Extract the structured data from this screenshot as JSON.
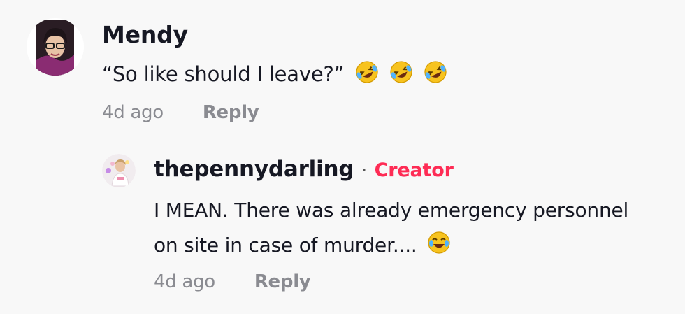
{
  "comments": [
    {
      "username": "Mendy",
      "text": "“So like should I leave?”",
      "emojis": [
        "rolling-on-floor-laughing-emoji",
        "rolling-on-floor-laughing-emoji",
        "rolling-on-floor-laughing-emoji"
      ],
      "time": "4d ago",
      "reply_label": "Reply"
    }
  ],
  "replies": [
    {
      "username": "thepennydarling",
      "separator": "·",
      "badge": "Creator",
      "text_line1": "I MEAN. There was already emergency personnel",
      "text_line2": "on site in case of murder....",
      "emoji": "face-with-tears-of-joy-emoji",
      "time": "4d ago",
      "reply_label": "Reply"
    }
  ],
  "colors": {
    "background": "#f8f8f8",
    "creator_badge": "#fe2c55",
    "meta": "#8a8b91",
    "text": "#161823"
  }
}
